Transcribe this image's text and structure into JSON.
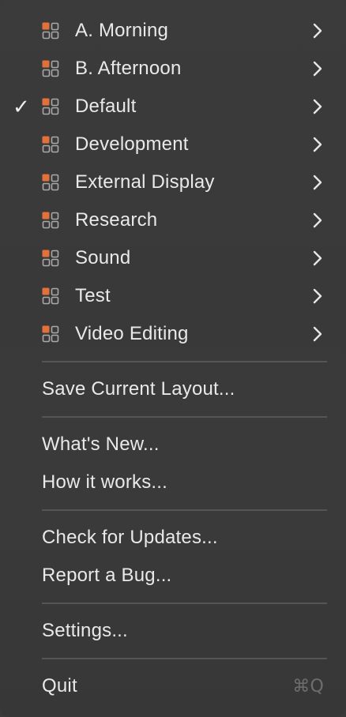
{
  "layouts": [
    {
      "label": "A. Morning",
      "checked": false
    },
    {
      "label": "B. Afternoon",
      "checked": false
    },
    {
      "label": "Default",
      "checked": true
    },
    {
      "label": "Development",
      "checked": false
    },
    {
      "label": "External Display",
      "checked": false
    },
    {
      "label": "Research",
      "checked": false
    },
    {
      "label": "Sound",
      "checked": false
    },
    {
      "label": "Test",
      "checked": false
    },
    {
      "label": "Video Editing",
      "checked": false
    }
  ],
  "checkmark": "✓",
  "actions": {
    "save_layout": "Save Current Layout...",
    "whats_new": "What's New...",
    "how_it_works": "How it works...",
    "check_updates": "Check for Updates...",
    "report_bug": "Report a Bug...",
    "settings": "Settings...",
    "quit": "Quit",
    "quit_shortcut": "⌘Q"
  },
  "colors": {
    "icon_accent": "#e2703a",
    "icon_outline": "#a9a9a9",
    "text": "#e9e9e9",
    "shortcut": "#6e6e6e"
  }
}
